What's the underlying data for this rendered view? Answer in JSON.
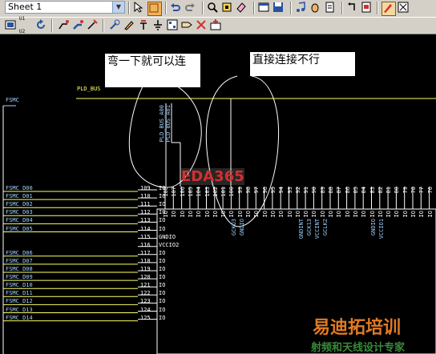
{
  "toolbar": {
    "sheet_select_value": "Sheet 1",
    "row2_labels": [
      "U1 U2"
    ]
  },
  "notes": [
    {
      "text": "弯一下就可以连"
    },
    {
      "text": "直接连接不行"
    }
  ],
  "schematic": {
    "pld_bus_label": "PLD_BUS",
    "fsmc_label": "FSMC",
    "bus_entries": [
      "PLD_BUS_A00",
      "PLD_BUS_A01"
    ],
    "left_nets": [
      "FSMC_D00",
      "FSMC_D01",
      "FSMC_D02",
      "FSMC_D03",
      "FSMC_D04",
      "FSMC_D05",
      "FSMC_D06",
      "FSMC_D07",
      "FSMC_D08",
      "FSMC_D09",
      "FSMC_D10",
      "FSMC_D11",
      "FSMC_D12",
      "FSMC_D13",
      "FSMC_D14"
    ],
    "left_pin_numbers": [
      "109",
      "110",
      "111",
      "112",
      "113",
      "114",
      "115",
      "116",
      "117",
      "118",
      "119",
      "120",
      "121",
      "122",
      "123",
      "124",
      "125"
    ],
    "left_pin_names": [
      "IO",
      "IO",
      "IO",
      "IO",
      "IO",
      "IO",
      "GNDIO",
      "VCCIO2",
      "IO",
      "IO",
      "IO",
      "IO",
      "IO",
      "IO",
      "IO",
      "IO",
      "IO"
    ],
    "top_pin_numbers": [
      "108",
      "107",
      "106",
      "105",
      "104",
      "103",
      "102",
      "101",
      "100",
      "99",
      "98",
      "97",
      "96",
      "95",
      "94",
      "93",
      "92",
      "91",
      "90",
      "89",
      "88",
      "87",
      "86",
      "85",
      "84",
      "83",
      "82",
      "81",
      "80",
      "79",
      "78",
      "77",
      "76"
    ],
    "top_pin_names": [
      "IO",
      "IO",
      "IO",
      "IO",
      "IO",
      "IO",
      "IO",
      "IO",
      "IO",
      "IO",
      "IO",
      "IO",
      "IO",
      "IO",
      "IO",
      "IO",
      "IO",
      "IO",
      "IO",
      "IO",
      "IO",
      "IO",
      "IO",
      "IO",
      "IO",
      "IO",
      "IO",
      "IO",
      "IO",
      "IO",
      "IO",
      "IO",
      "IO"
    ],
    "top_special_names": [
      "GCKO3",
      "GNDIO",
      "GNDINT",
      "GCK13",
      "VCCINT",
      "GCLK2",
      "GNDIO",
      "VCCIO1"
    ]
  },
  "watermark": {
    "eda": "EDA365",
    "brand": "易迪拓培训",
    "sub": "射频和天线设计专家"
  },
  "colors": {
    "wire": "#ffffff",
    "net_label": "#9fd1ff",
    "pin": "#ffffff",
    "accent": "#d42f2f"
  }
}
